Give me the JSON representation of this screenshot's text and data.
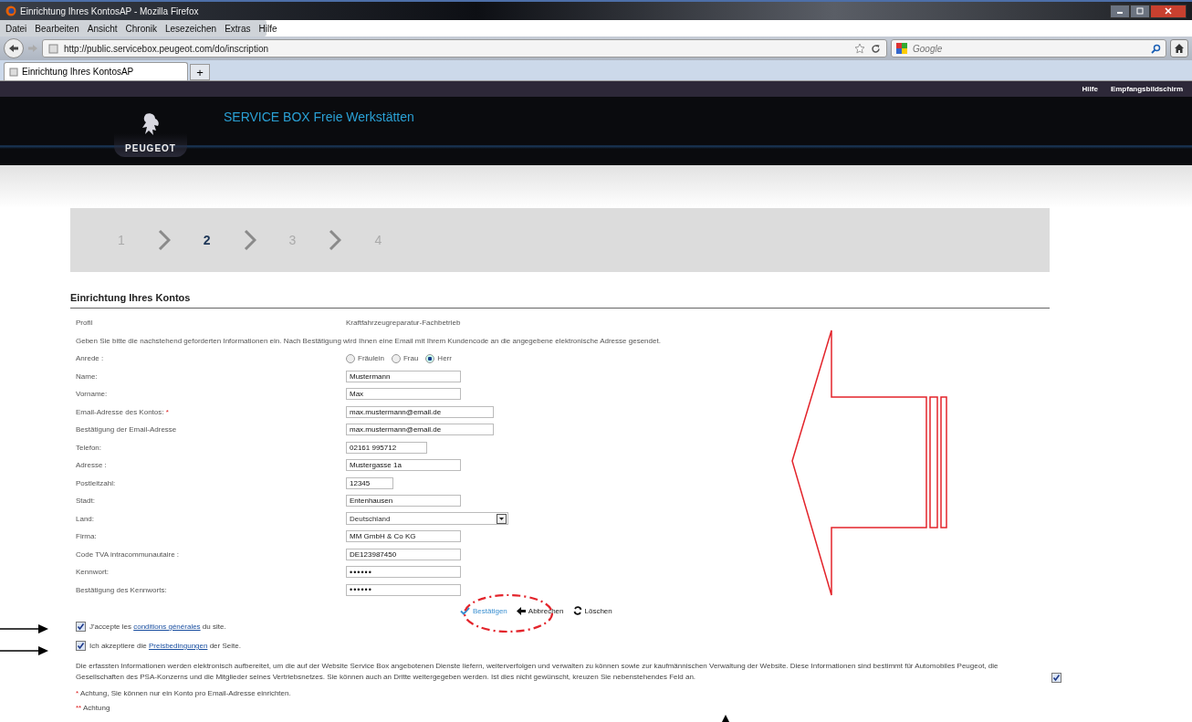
{
  "window": {
    "title": "Einrichtung Ihres KontosAP - Mozilla Firefox"
  },
  "menu": [
    "Datei",
    "Bearbeiten",
    "Ansicht",
    "Chronik",
    "Lesezeichen",
    "Extras",
    "Hilfe"
  ],
  "address_bar": {
    "value": "http://public.servicebox.peugeot.com/do/inscription"
  },
  "search": {
    "placeholder": "Google"
  },
  "tabs": [
    {
      "label": "Einrichtung Ihres KontosAP",
      "selected": true
    }
  ],
  "new_tab": "+",
  "top_links": [
    "Hilfe",
    "Empfangsbildschirm"
  ],
  "header": {
    "brand": "PEUGEOT",
    "title": "SERVICE BOX Freie Werkstätten"
  },
  "steps": [
    {
      "label": "1",
      "selected": false
    },
    {
      "label": "2",
      "selected": true
    },
    {
      "label": "3",
      "selected": false
    },
    {
      "label": "4",
      "selected": false
    }
  ],
  "page_title": "Einrichtung Ihres Kontos",
  "form": [
    {
      "kind": "text",
      "label": "Profil",
      "value": "Kraftfahrzeugreparatur-Fachbetrieb"
    },
    {
      "kind": "note",
      "text": "Geben Sie bitte die nachstehend geforderten Informationen ein. Nach Bestätigung wird Ihnen eine Email mit Ihrem Kundencode an die angegebene elektronische Adresse gesendet."
    },
    {
      "kind": "radio",
      "label": "Anrede :",
      "options": [
        {
          "label": "Fräulein",
          "selected": false
        },
        {
          "label": "Frau",
          "selected": false
        },
        {
          "label": "Herr",
          "selected": true
        }
      ]
    },
    {
      "kind": "input",
      "label": "Name:",
      "value": "Mustermann"
    },
    {
      "kind": "input",
      "label": "Vorname:",
      "value": "Max"
    },
    {
      "kind": "input",
      "label": "Email-Adresse des Kontos:",
      "required_mark": "*",
      "value": "max.mustermann@email.de"
    },
    {
      "kind": "input",
      "label": "Bestätigung der Email-Adresse",
      "value": "max.mustermann@email.de"
    },
    {
      "kind": "input",
      "label": "Telefon:",
      "value": "02161 995712"
    },
    {
      "kind": "input",
      "label": "Adresse :",
      "value": "Mustergasse 1a"
    },
    {
      "kind": "input",
      "label": "Postleitzahl:",
      "value": "12345"
    },
    {
      "kind": "input",
      "label": "Stadt:",
      "value": "Entenhausen"
    },
    {
      "kind": "select",
      "label": "Land:",
      "value": "Deutschland"
    },
    {
      "kind": "input",
      "label": "Firma:",
      "value": "MM GmbH & Co KG"
    },
    {
      "kind": "input",
      "label": "Code TVA intracommunautaire :",
      "value": "DE123987450"
    },
    {
      "kind": "password",
      "label": "Kennwort:",
      "value": "••••••"
    },
    {
      "kind": "password",
      "label": "Bestätigung des Kennworts:",
      "value": "••••••"
    }
  ],
  "actions": [
    {
      "label": "Bestätigen",
      "kind": "confirm"
    },
    {
      "label": "Abbrechen",
      "kind": "cancel"
    },
    {
      "label": "Löschen",
      "kind": "reset"
    }
  ],
  "agreements": [
    {
      "checked": true,
      "before": "J'accepte les",
      "link": "conditions générales",
      "after": "du site."
    },
    {
      "checked": true,
      "before": "Ich akzeptiere die",
      "link": "Preisbedingungen",
      "after": "der Seite."
    }
  ],
  "privacy": {
    "text": "Die erfassten Informationen werden elektronisch aufbereitet, um die auf der Website Service Box angebotenen Dienste liefern, weiterverfolgen und verwalten zu können sowie zur kaufmännischen Verwaltung der Website. Diese Informationen sind bestimmt für Automobiles Peugeot, die Gesellschaften des PSA-Konzerns und die Mitglieder seines Vertriebsnetzes. Sie können auch an Dritte weitergegeben werden. Ist dies nicht gewünscht, kreuzen Sie nebenstehendes Feld an.",
    "checked": true
  },
  "footnotes": [
    {
      "mark": "*",
      "text": "Achtung, Sie können nur ein Konto pro Email-Adresse einrichten."
    },
    {
      "mark": "**",
      "text": "Achtung"
    }
  ]
}
